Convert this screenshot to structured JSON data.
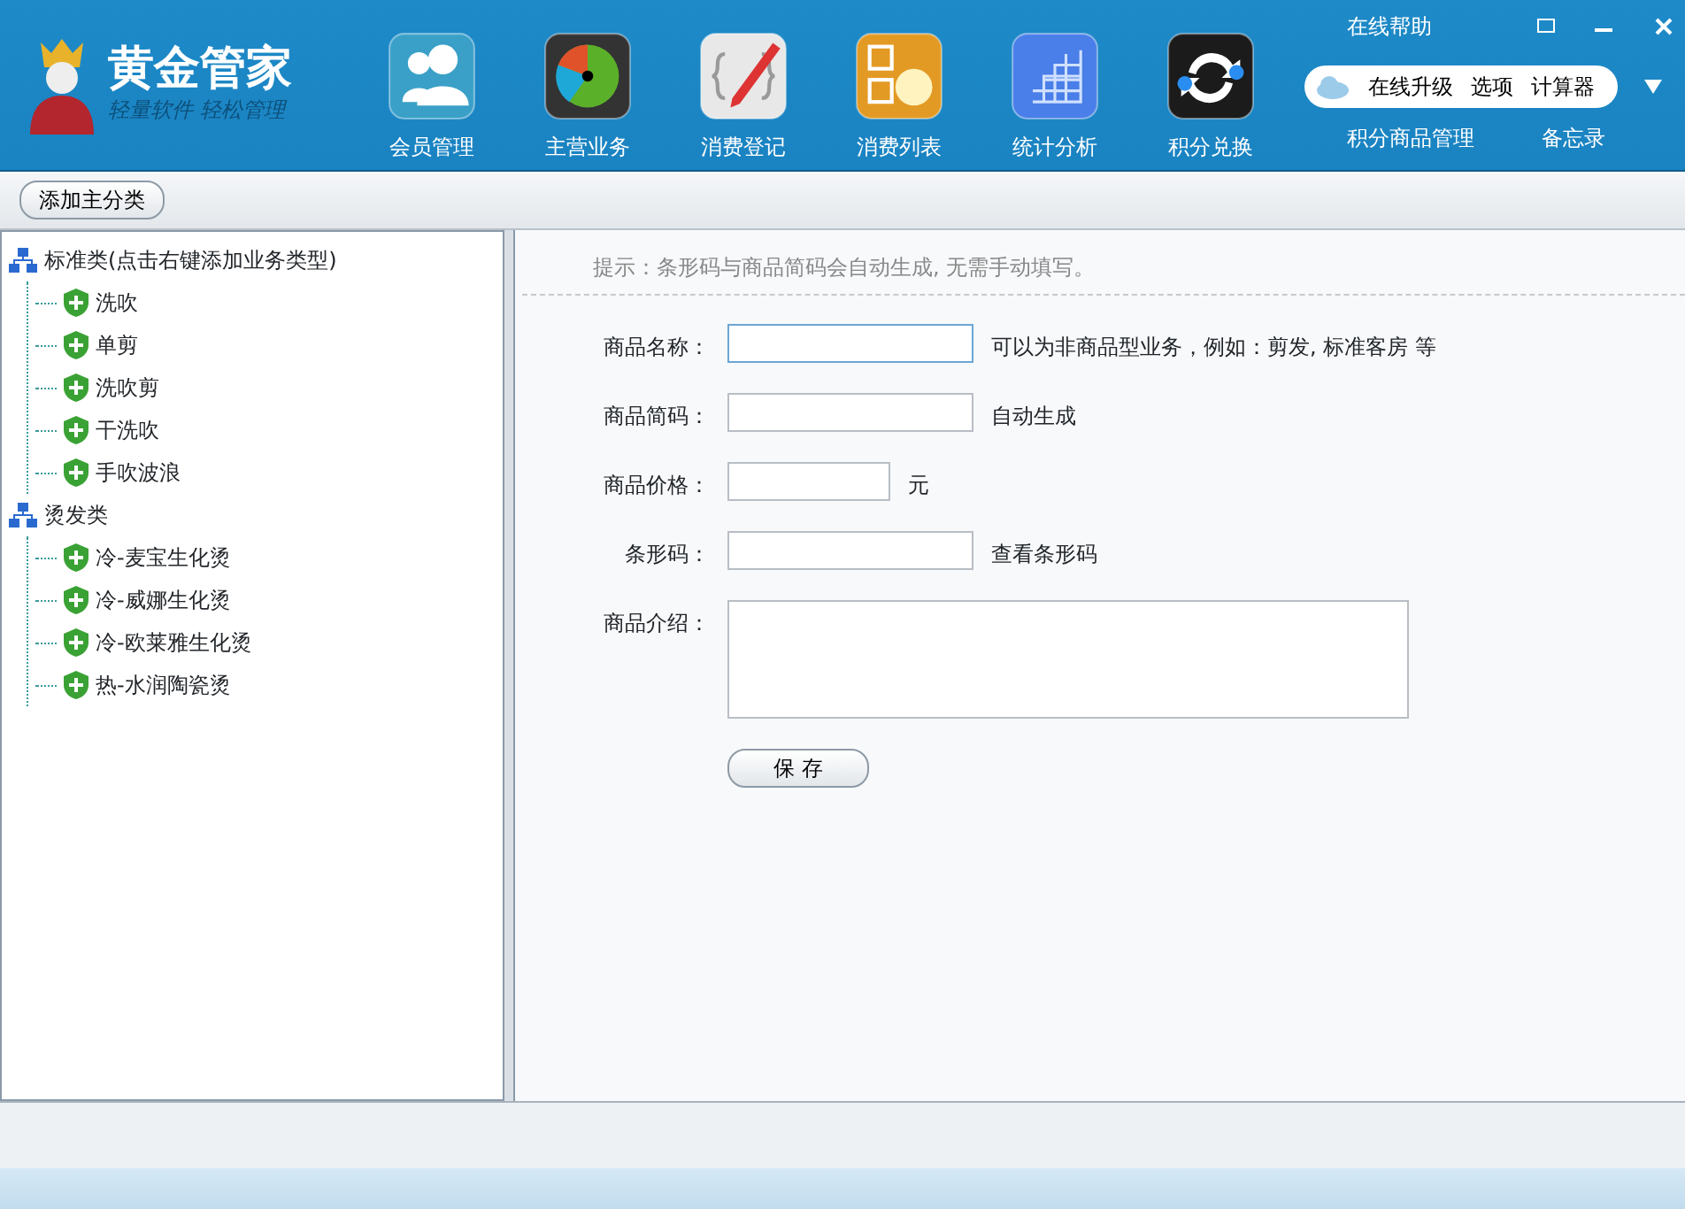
{
  "app": {
    "title": "黄金管家",
    "slogan": "轻量软件 轻松管理"
  },
  "nav": [
    {
      "label": "会员管理",
      "kind": "members"
    },
    {
      "label": "主营业务",
      "kind": "business"
    },
    {
      "label": "消费登记",
      "kind": "register"
    },
    {
      "label": "消费列表",
      "kind": "list"
    },
    {
      "label": "统计分析",
      "kind": "stats"
    },
    {
      "label": "积分兑换",
      "kind": "exchange"
    }
  ],
  "help_link": "在线帮助",
  "quick_menu": [
    "在线升级",
    "选项",
    "计算器"
  ],
  "links": [
    "积分商品管理",
    "备忘录"
  ],
  "toolbar": {
    "add_button": "添加主分类"
  },
  "tree": [
    {
      "label": "标准类(点击右键添加业务类型)",
      "children": [
        {
          "label": "洗吹"
        },
        {
          "label": "单剪"
        },
        {
          "label": "洗吹剪"
        },
        {
          "label": "干洗吹"
        },
        {
          "label": "手吹波浪"
        }
      ]
    },
    {
      "label": "烫发类",
      "children": [
        {
          "label": "冷-麦宝生化烫"
        },
        {
          "label": "冷-威娜生化烫"
        },
        {
          "label": "冷-欧莱雅生化烫"
        },
        {
          "label": "热-水润陶瓷烫"
        }
      ]
    }
  ],
  "form": {
    "hint": "提示：条形码与商品简码会自动生成, 无需手动填写。",
    "fields": [
      {
        "label": "商品名称：",
        "kind": "text",
        "focused": true,
        "note": "可以为非商品型业务，例如：剪发, 标准客房 等"
      },
      {
        "label": "商品简码：",
        "kind": "text",
        "focused": false,
        "note": "自动生成"
      },
      {
        "label": "商品价格：",
        "kind": "short",
        "focused": false,
        "note": "元"
      },
      {
        "label": "条形码：",
        "kind": "text",
        "focused": false,
        "note": "查看条形码"
      },
      {
        "label": "商品介绍：",
        "kind": "area",
        "focused": false
      }
    ],
    "save_button": "保 存"
  }
}
